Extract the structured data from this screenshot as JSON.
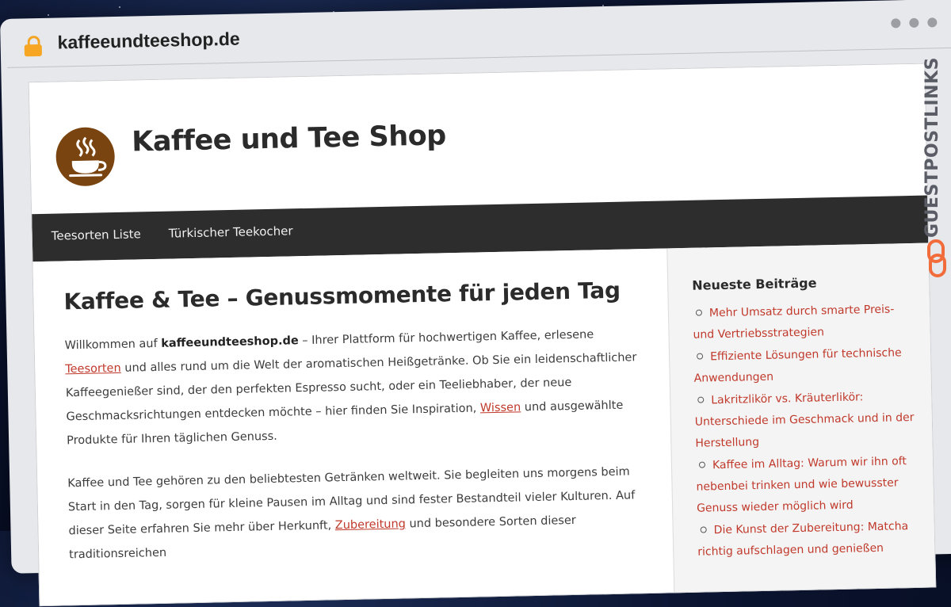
{
  "browser": {
    "url": "kaffeeundteeshop.de"
  },
  "header": {
    "site_title": "Kaffee und Tee Shop"
  },
  "nav": {
    "items": [
      {
        "label": "Teesorten Liste"
      },
      {
        "label": "Türkischer Teekocher"
      }
    ]
  },
  "main": {
    "title": "Kaffee & Tee – Genussmomente für jeden Tag",
    "p1": {
      "before": "Willkommen auf ",
      "bold": "kaffeeundteeshop.de",
      "after_bold": " – Ihrer Plattform für hochwertigen Kaffee, erlesene ",
      "link1": "Teesorten",
      "mid": " und alles rund um die Welt der aromatischen Heißgetränke. Ob Sie ein leidenschaftlicher Kaffeegenießer sind, der den perfekten Espresso sucht, oder ein Teeliebhaber, der neue Geschmacksrichtungen entdecken möchte – hier finden Sie Inspiration, ",
      "link2": "Wissen",
      "end": " und ausgewählte Produkte für Ihren täglichen Genuss."
    },
    "p2": {
      "text": "Kaffee und Tee gehören zu den beliebtesten Getränken weltweit. Sie begleiten uns morgens beim Start in den Tag, sorgen für kleine Pausen im Alltag und sind fester Bestandteil vieler Kulturen. Auf dieser Seite erfahren Sie mehr über Herkunft, ",
      "link": "Zubereitung",
      "end": " und besondere Sorten dieser traditionsreichen"
    }
  },
  "sidebar": {
    "title": "Neueste Beiträge",
    "posts": [
      {
        "label": "Mehr Umsatz durch smarte Preis- und Vertriebsstrategien"
      },
      {
        "label": "Effiziente Lösungen für technische Anwendungen"
      },
      {
        "label": "Lakritzlikör vs. Kräuterlikör: Unterschiede im Geschmack und in der Herstellung"
      },
      {
        "label": "Kaffee im Alltag: Warum wir ihn oft nebenbei trinken und wie bewusster Genuss wieder möglich wird"
      },
      {
        "label": "Die Kunst der Zubereitung: Matcha richtig aufschlagen und genießen"
      }
    ]
  },
  "badge": {
    "text": "GUESTPOSTLINKS"
  },
  "colors": {
    "link": "#c0392b",
    "nav_bg": "#2d2d2d",
    "logo_bg": "#7a4410",
    "lock": "#f6a623",
    "badge_accent": "#f26b3a"
  }
}
